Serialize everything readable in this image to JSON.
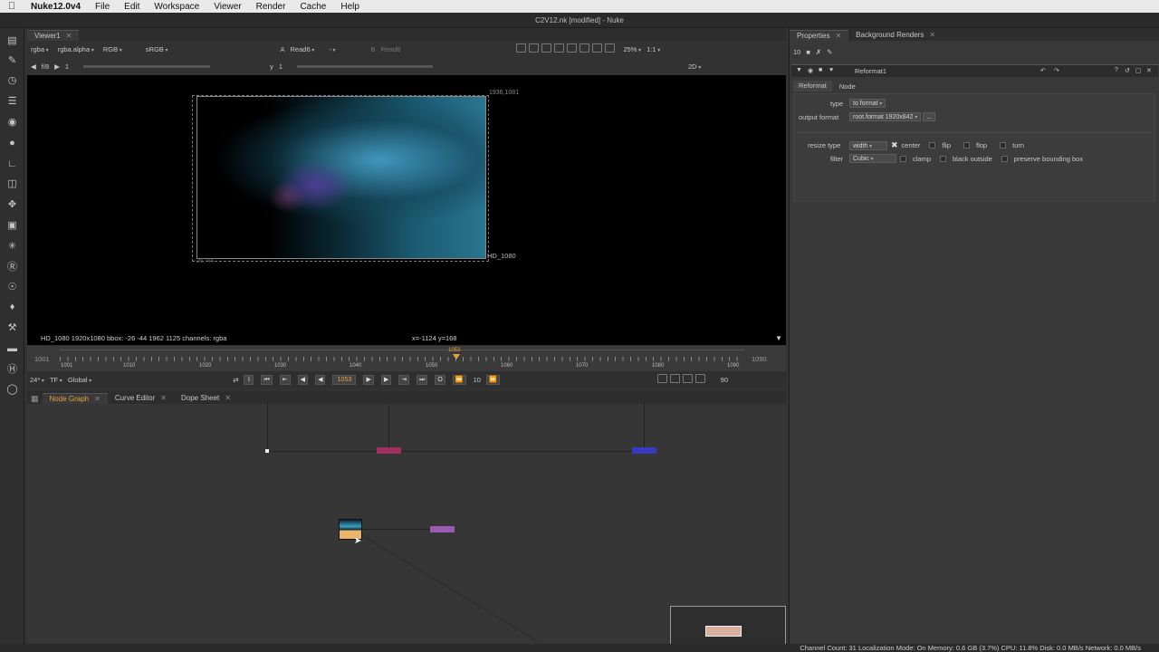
{
  "menubar": {
    "app_name": "Nuke12.0v4",
    "items": [
      "File",
      "Edit",
      "Workspace",
      "Viewer",
      "Render",
      "Cache",
      "Help"
    ]
  },
  "window_title": "C2V12.nk [modified] - Nuke",
  "viewer": {
    "tab_label": "Viewer1",
    "channels": "rgba",
    "alpha_channel": "rgba.alpha",
    "display_channels": "RGB",
    "colorspace": "sRGB",
    "input_a_label": "A",
    "input_a": "Read6",
    "input_mid": "-",
    "input_b_label": "B",
    "input_b": "Read6",
    "zoom": "25%",
    "ratio": "1:1",
    "fstop": "f/8",
    "gain": "1",
    "gamma_label": "y",
    "gamma": "1",
    "view_mode": "2D",
    "format_top_right": "1936,1081",
    "format_bottom_left": "-26,-44",
    "format_name": "HD_1080",
    "status_info": "HD_1080 1920x1080  bbox: -26 -44 1962 1125 channels: rgba",
    "cursor_info": "x=-1124 y=168"
  },
  "timeline": {
    "start": "1001",
    "end": "1090",
    "current": "1053",
    "ticks": [
      "1001",
      "1010",
      "1020",
      "1030",
      "1040",
      "1050",
      "1060",
      "1070",
      "1080",
      "1090"
    ],
    "fps": "24*",
    "tf": "TF",
    "scope": "Global",
    "frame_display": "1053",
    "step": "10",
    "end_frame": "90"
  },
  "node_graph_tabs": [
    {
      "label": "Node Graph",
      "active": true
    },
    {
      "label": "Curve Editor",
      "active": false
    },
    {
      "label": "Dope Sheet",
      "active": false
    }
  ],
  "properties": {
    "tabs": [
      {
        "label": "Properties",
        "active": true
      },
      {
        "label": "Background Renders",
        "active": false
      }
    ],
    "max_panels": "10",
    "node_name": "Reformat1",
    "sub_tabs": [
      "Reformat",
      "Node"
    ],
    "type_label": "type",
    "type_value": "to format",
    "output_format_label": "output format",
    "output_format_value": "root.format 1920x842",
    "resize_type_label": "resize type",
    "resize_type_value": "width",
    "center_label": "center",
    "flip_label": "flip",
    "flop_label": "flop",
    "turn_label": "turn",
    "filter_label": "filter",
    "filter_value": "Cubic",
    "clamp_label": "clamp",
    "black_outside_label": "black outside",
    "preserve_bbox_label": "preserve bounding box"
  },
  "status_bar": "Channel Count: 31  Localization Mode: On  Memory: 0.6 GB (3.7%)  CPU: 11.8%  Disk: 0.0 MB/s  Network: 0.0 MB/s",
  "colors": {
    "accent_orange": "#e8a13a",
    "node_pink": "#a03060",
    "node_blue": "#3a3ac0",
    "node_purple": "#9a5ab0",
    "read_node": "#e9b46a"
  }
}
